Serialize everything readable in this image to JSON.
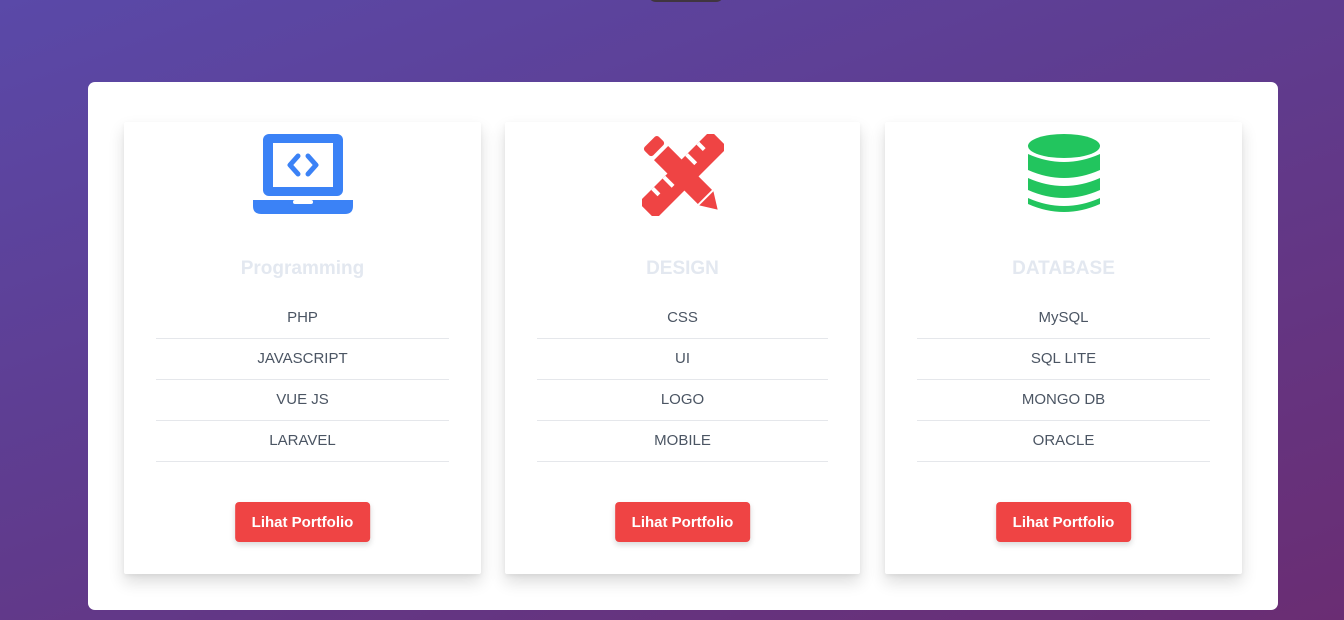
{
  "colors": {
    "programming_icon": "#3b82f6",
    "design_icon": "#ef4444",
    "database_icon": "#22c55e",
    "button_bg": "#ef4444",
    "title_text": "#e3e8f0"
  },
  "cards": [
    {
      "icon": "laptop-code-icon",
      "title": "Programming",
      "items": [
        "PHP",
        "JAVASCRIPT",
        "VUE JS",
        "LARAVEL"
      ],
      "button_label": "Lihat Portfolio"
    },
    {
      "icon": "pencil-ruler-icon",
      "title": "DESIGN",
      "items": [
        "CSS",
        "UI",
        "LOGO",
        "MOBILE"
      ],
      "button_label": "Lihat Portfolio"
    },
    {
      "icon": "database-icon",
      "title": "DATABASE",
      "items": [
        "MySQL",
        "SQL LITE",
        "MONGO DB",
        "ORACLE"
      ],
      "button_label": "Lihat Portfolio"
    }
  ]
}
